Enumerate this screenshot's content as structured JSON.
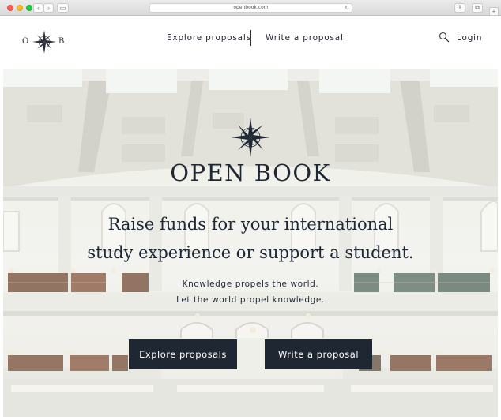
{
  "browser": {
    "url": "openbook.com"
  },
  "header": {
    "logo_left": "O",
    "logo_right": "B",
    "nav": {
      "explore": "Explore proposals",
      "write": "Write a proposal",
      "login": "Login"
    }
  },
  "hero": {
    "title": "OPEN BOOK",
    "subtitle_line1": "Raise funds for your international",
    "subtitle_line2": "study experience or support a student.",
    "tagline_line1": "Knowledge propels the world.",
    "tagline_line2": "Let the world propel knowledge.",
    "cta_explore": "Explore proposals",
    "cta_write": "Write a proposal"
  },
  "colors": {
    "primary_dark": "#1f2733",
    "button_text": "#ffffff",
    "background": "#ffffff"
  },
  "icons": [
    "compass-rose-icon",
    "search-icon",
    "back-arrow-icon",
    "forward-arrow-icon",
    "sidebar-icon",
    "reload-icon",
    "share-icon",
    "tabs-icon",
    "new-tab-icon"
  ]
}
